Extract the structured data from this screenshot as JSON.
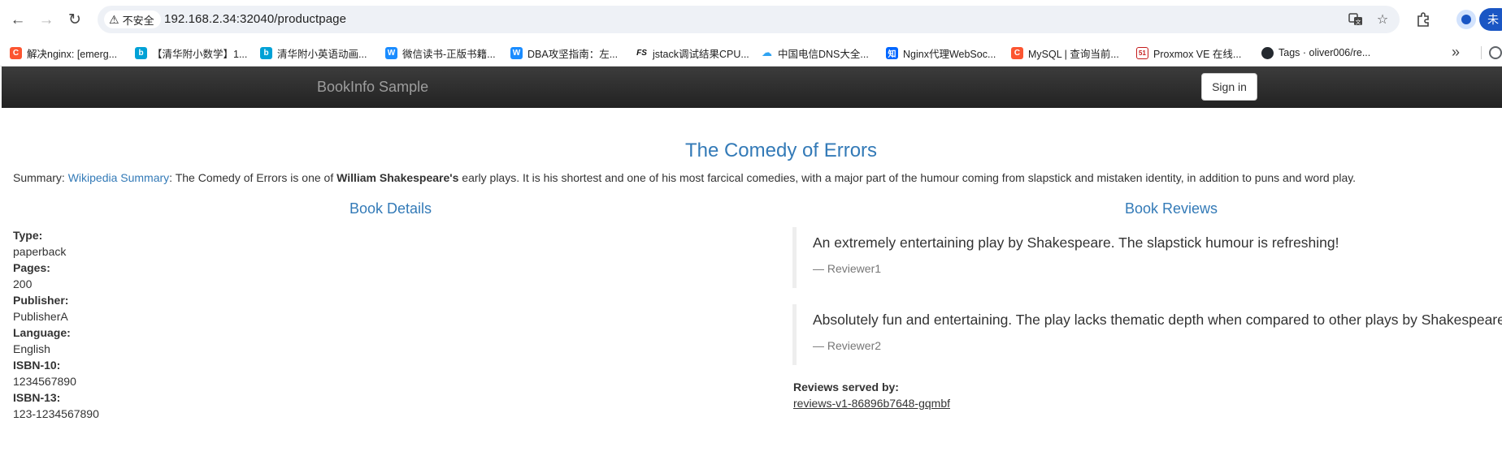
{
  "browser": {
    "security_label": "不安全",
    "url": "192.168.2.34:32040/productpage",
    "bookmarks": [
      {
        "label": "解决nginx: [emerg...",
        "icon": "csdn-icon",
        "color": "#fc5531",
        "glyph": "C"
      },
      {
        "label": "【清华附小数学】1...",
        "icon": "bilibili-icon",
        "color": "#00a1d6",
        "glyph": "b"
      },
      {
        "label": "清华附小英语动画...",
        "icon": "bilibili-icon",
        "color": "#00a1d6",
        "glyph": "b"
      },
      {
        "label": "微信读书-正版书籍...",
        "icon": "weread-icon",
        "color": "#1a8cff",
        "glyph": "W"
      },
      {
        "label": "DBA攻坚指南：左...",
        "icon": "weread-icon",
        "color": "#1a8cff",
        "glyph": "W"
      },
      {
        "label": "jstack调试结果CPU...",
        "icon": "fs-icon",
        "color": "#111111",
        "glyph": "FS"
      },
      {
        "label": "中国电信DNS大全...",
        "icon": "cloud-icon",
        "color": "#2ea3f2",
        "glyph": "☁"
      },
      {
        "label": "Nginx代理WebSoc...",
        "icon": "zhihu-icon",
        "color": "#0066ff",
        "glyph": "知"
      },
      {
        "label": "MySQL | 查询当前...",
        "icon": "csdn-icon",
        "color": "#fc5531",
        "glyph": "C"
      },
      {
        "label": "Proxmox VE 在线...",
        "icon": "cto51-icon",
        "color": "#c41b1b",
        "glyph": "51"
      },
      {
        "label": "Tags · oliver006/re...",
        "icon": "github-icon",
        "color": "#24292f",
        "glyph": "●"
      }
    ]
  },
  "app": {
    "brand": "BookInfo Sample",
    "signin_label": "Sign in",
    "title": "The Comedy of Errors",
    "summary": {
      "prefix": "Summary: ",
      "link": "Wikipedia Summary",
      "text1": ": The Comedy of Errors is one of ",
      "bold": "William Shakespeare's",
      "text2": " early plays. It is his shortest and one of his most farcical comedies, with a major part of the humour coming from slapstick and mistaken identity, in addition to puns and word play."
    },
    "details_title": "Book Details",
    "reviews_title": "Book Reviews",
    "details": [
      {
        "label": "Type:",
        "value": "paperback"
      },
      {
        "label": "Pages:",
        "value": "200"
      },
      {
        "label": "Publisher:",
        "value": "PublisherA"
      },
      {
        "label": "Language:",
        "value": "English"
      },
      {
        "label": "ISBN-10:",
        "value": "1234567890"
      },
      {
        "label": "ISBN-13:",
        "value": "123-1234567890"
      }
    ],
    "reviews": [
      {
        "text": "An extremely entertaining play by Shakespeare. The slapstick humour is refreshing!",
        "author": "— Reviewer1"
      },
      {
        "text": "Absolutely fun and entertaining. The play lacks thematic depth when compared to other plays by Shakespeare.",
        "author": "— Reviewer2"
      }
    ],
    "served_by_label": "Reviews served by:",
    "served_by_value": "reviews-v1-86896b7648-gqmbf"
  }
}
